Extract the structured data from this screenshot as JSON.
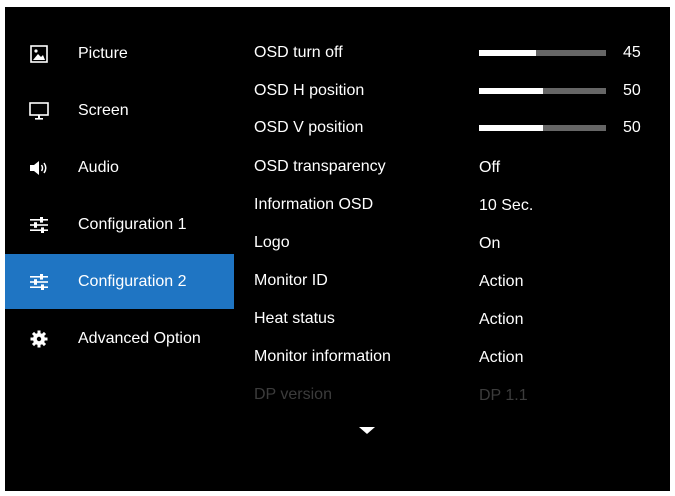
{
  "sidebar": {
    "items": [
      {
        "label": "Picture",
        "icon": "picture-icon",
        "selected": false
      },
      {
        "label": "Screen",
        "icon": "monitor-icon",
        "selected": false
      },
      {
        "label": "Audio",
        "icon": "speaker-icon",
        "selected": false
      },
      {
        "label": "Configuration 1",
        "icon": "sliders-icon",
        "selected": false
      },
      {
        "label": "Configuration 2",
        "icon": "sliders-icon",
        "selected": true
      },
      {
        "label": "Advanced Option",
        "icon": "gear-icon",
        "selected": false
      }
    ],
    "selected_color": "#1f75c3"
  },
  "settings": {
    "rows": [
      {
        "label": "OSD turn off",
        "type": "slider",
        "value": "45",
        "level": 0.45
      },
      {
        "label": "OSD H position",
        "type": "slider",
        "value": "50",
        "level": 0.5
      },
      {
        "label": "OSD V position",
        "type": "slider",
        "value": "50",
        "level": 0.5
      },
      {
        "label": "OSD transparency",
        "type": "text",
        "value": "Off"
      },
      {
        "label": "Information OSD",
        "type": "text",
        "value": "10 Sec."
      },
      {
        "label": "Logo",
        "type": "text",
        "value": "On"
      },
      {
        "label": "Monitor ID",
        "type": "text",
        "value": "Action"
      },
      {
        "label": "Heat status",
        "type": "text",
        "value": "Action"
      },
      {
        "label": "Monitor information",
        "type": "text",
        "value": "Action"
      },
      {
        "label": "DP version",
        "type": "text",
        "value": "DP 1.1",
        "disabled": true
      }
    ],
    "more_indicator": "chevron-down-icon"
  }
}
